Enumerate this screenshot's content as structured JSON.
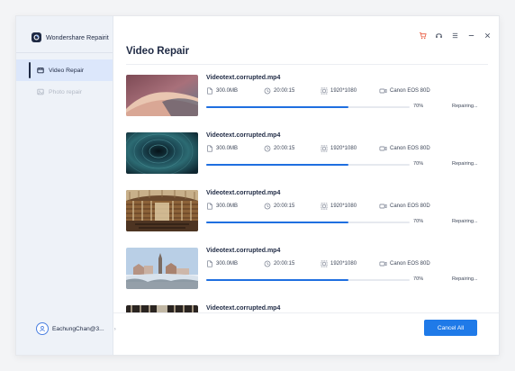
{
  "app": {
    "title": "Wondershare Repairit"
  },
  "sidebar": {
    "items": [
      {
        "label": "Video Repair",
        "active": true,
        "icon": "video-icon"
      },
      {
        "label": "Photo repair",
        "active": false,
        "icon": "photo-icon"
      }
    ],
    "user": {
      "name": "EachungChan@3...",
      "icon": "user-avatar-icon"
    }
  },
  "header": {
    "title": "Video Repair",
    "controls": [
      "cart-icon",
      "headset-icon",
      "menu-icon",
      "minimize-icon",
      "close-icon"
    ]
  },
  "colors": {
    "accent": "#1f7ae8",
    "progress": "#1f6fe0",
    "cart": "#e8563a",
    "navy": "#1f2a44"
  },
  "videos": [
    {
      "name": "Videotext.corrupted.mp4",
      "size": "300.0MB",
      "duration": "20:00:15",
      "resolution": "1920*1080",
      "camera": "Canon EOS 80D",
      "progress_label": "70%",
      "progress": 0.7,
      "status": "Repairing..."
    },
    {
      "name": "Videotext.corrupted.mp4",
      "size": "300.0MB",
      "duration": "20:00:15",
      "resolution": "1920*1080",
      "camera": "Canon EOS 80D",
      "progress_label": "70%",
      "progress": 0.7,
      "status": "Repairing..."
    },
    {
      "name": "Videotext.corrupted.mp4",
      "size": "300.0MB",
      "duration": "20:00:15",
      "resolution": "1920*1080",
      "camera": "Canon EOS 80D",
      "progress_label": "70%",
      "progress": 0.7,
      "status": "Repairing..."
    },
    {
      "name": "Videotext.corrupted.mp4",
      "size": "300.0MB",
      "duration": "20:00:15",
      "resolution": "1920*1080",
      "camera": "Canon EOS 80D",
      "progress_label": "70%",
      "progress": 0.7,
      "status": "Repairing..."
    },
    {
      "name": "Videotext.corrupted.mp4"
    }
  ],
  "footer": {
    "cancel_label": "Cancel All"
  }
}
